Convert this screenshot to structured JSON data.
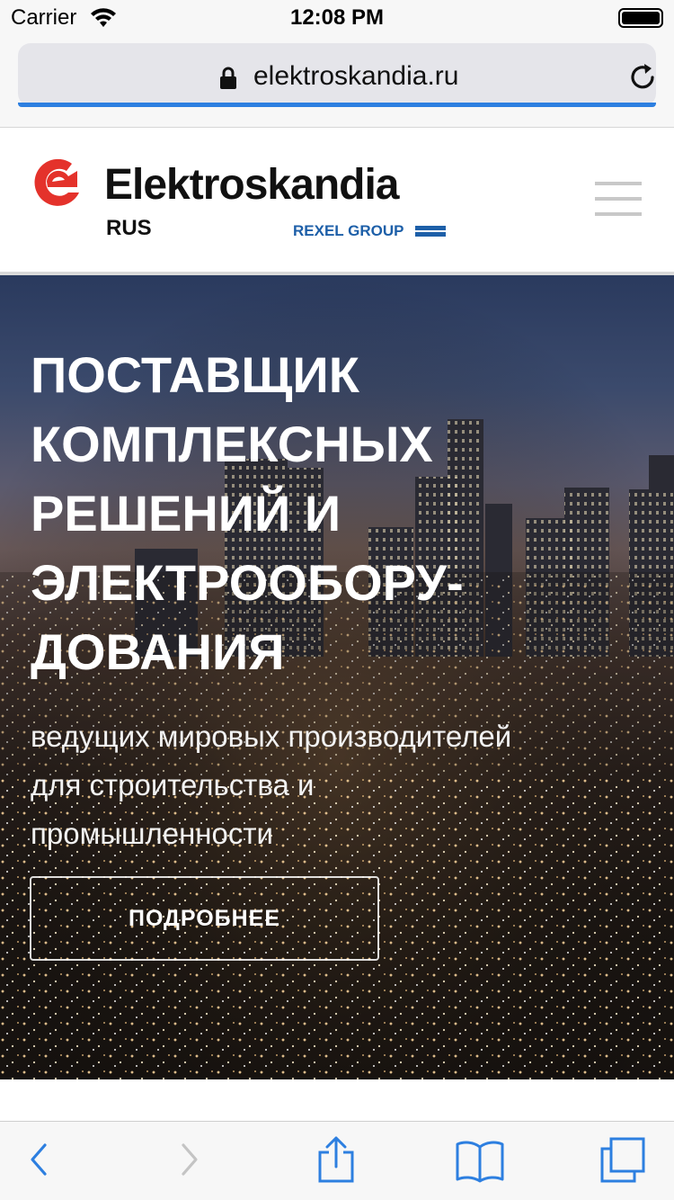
{
  "status_bar": {
    "carrier": "Carrier",
    "time": "12:08 PM"
  },
  "browser": {
    "url": "elektroskandia.ru",
    "icons": [
      "lock-icon",
      "reload-icon"
    ]
  },
  "header": {
    "brand": "Elektroskandia",
    "sub_brand": "RUS",
    "group": "REXEL GROUP",
    "logo_color": "#e4322b",
    "group_color": "#1d5fa8"
  },
  "hero": {
    "title_lines": [
      "ПОСТАВЩИК",
      "КОМПЛЕКСНЫХ",
      "РЕШЕНИЙ И",
      "ЭЛЕКТРООБОРУ-",
      "ДОВАНИЯ"
    ],
    "subtitle_lines": [
      "ведущих мировых производителей",
      "для строительства и",
      "промышленности"
    ],
    "button_label": "ПОДРОБНЕЕ"
  },
  "toolbar": {
    "icons": [
      "back-icon",
      "forward-icon",
      "share-icon",
      "bookmarks-icon",
      "tabs-icon"
    ],
    "accent": "#2d7fe0"
  }
}
